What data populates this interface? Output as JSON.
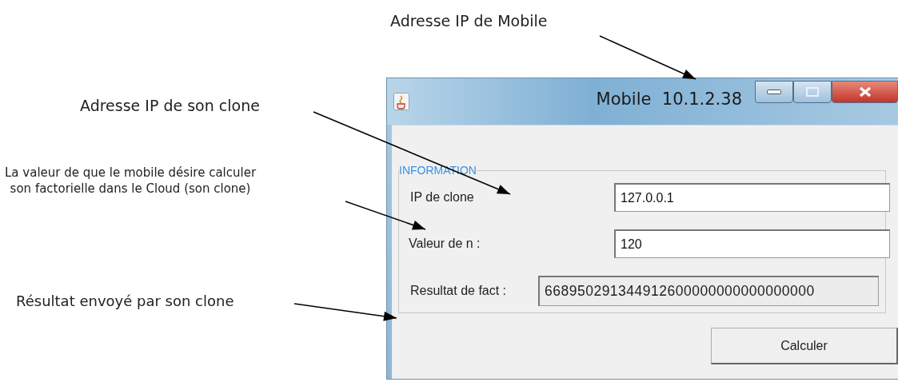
{
  "annotations": [
    {
      "text": "Adresse IP de Mobile"
    },
    {
      "text": "Adresse IP de son clone"
    },
    {
      "text": "La valeur de que le mobile désire calculer\nson factorielle dans le Cloud (son clone)"
    },
    {
      "text": "Résultat envoyé par son clone"
    }
  ],
  "window": {
    "title": "Mobile  10.1.2.38"
  },
  "group": {
    "title": "INFORMATION"
  },
  "fields": [
    {
      "label": "IP de clone",
      "value": "127.0.0.1",
      "disabled": false
    },
    {
      "label": "Valeur de n :",
      "value": "120",
      "disabled": false
    },
    {
      "label": "Resultat de fact :",
      "value": "668950291344912600000000000000000",
      "disabled": true
    }
  ],
  "buttons": [
    "Calculer"
  ]
}
